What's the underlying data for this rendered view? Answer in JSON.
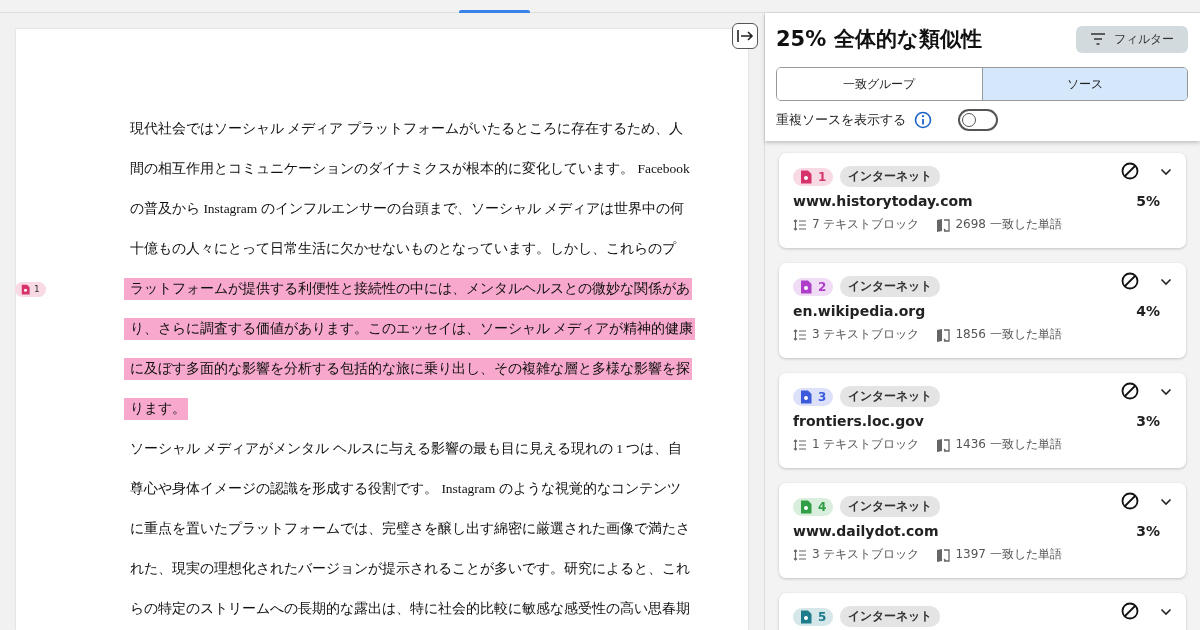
{
  "document": {
    "match_marker": {
      "number": "1",
      "color": "#d6336c"
    },
    "lines": [
      {
        "text": "現代社会ではソーシャル メディア プラットフォームがいたるところに存在するため、人",
        "highlighted": false
      },
      {
        "text": "間の相互作用とコミュニケーションのダイナミクスが根本的に変化しています。 Facebook",
        "highlighted": false
      },
      {
        "text": "の普及から Instagram のインフルエンサーの台頭まで、ソーシャル メディアは世界中の何",
        "highlighted": false
      },
      {
        "text": "十億もの人々にとって日常生活に欠かせないものとなっています。しかし、これらのプ",
        "highlighted": false
      },
      {
        "text": "ラットフォームが提供する利便性と接続性の中には、メンタルヘルスとの微妙な関係があ",
        "highlighted": true
      },
      {
        "text": "り、さらに調査する価値があります。このエッセイは、ソーシャル メディアが精神的健康",
        "highlighted": true
      },
      {
        "text": "に及ぼす多面的な影響を分析する包括的な旅に乗り出し、その複雑な層と多様な影響を探",
        "highlighted": true
      },
      {
        "text": "ります。",
        "highlighted": true
      },
      {
        "text": "ソーシャル メディアがメンタル ヘルスに与える影響の最も目に見える現れの 1 つは、自",
        "highlighted": false
      },
      {
        "text": "尊心や身体イメージの認識を形成する役割です。 Instagram のような視覚的なコンテンツ",
        "highlighted": false
      },
      {
        "text": "に重点を置いたプラットフォームでは、完璧さを醸し出す綿密に厳選された画像で満たさ",
        "highlighted": false
      },
      {
        "text": "れた、現実の理想化されたバージョンが提示されることが多いです。研究によると、これ",
        "highlighted": false
      },
      {
        "text": "らの特定のストリームへの長期的な露出は、特に社会的比較に敏感な感受性の高い思春期",
        "highlighted": false
      }
    ]
  },
  "panel": {
    "title": "25% 全体的な類似性",
    "filter_button": "フィルター",
    "tabs": [
      {
        "label": "一致グループ",
        "selected": false
      },
      {
        "label": "ソース",
        "selected": true
      }
    ],
    "duplicate_toggle": {
      "label": "重複ソースを表示する",
      "on": false
    },
    "sources": [
      {
        "number": "1",
        "color": "#d6336c",
        "type": "インターネット",
        "domain": "www.historytoday.com",
        "percent": "5%",
        "blocks": "7 テキストブロック",
        "words": "2698 一致した単語"
      },
      {
        "number": "2",
        "color": "#ae3ec9",
        "type": "インターネット",
        "domain": "en.wikipedia.org",
        "percent": "4%",
        "blocks": "3 テキストブロック",
        "words": "1856 一致した単語"
      },
      {
        "number": "3",
        "color": "#3b5bdb",
        "type": "インターネット",
        "domain": "frontiers.loc.gov",
        "percent": "3%",
        "blocks": "1 テキストブロック",
        "words": "1436 一致した単語"
      },
      {
        "number": "4",
        "color": "#2f9e44",
        "type": "インターネット",
        "domain": "www.dailydot.com",
        "percent": "3%",
        "blocks": "3 テキストブロック",
        "words": "1397 一致した単語"
      },
      {
        "number": "5",
        "color": "#1c7c8c",
        "type": "インターネット"
      }
    ]
  }
}
